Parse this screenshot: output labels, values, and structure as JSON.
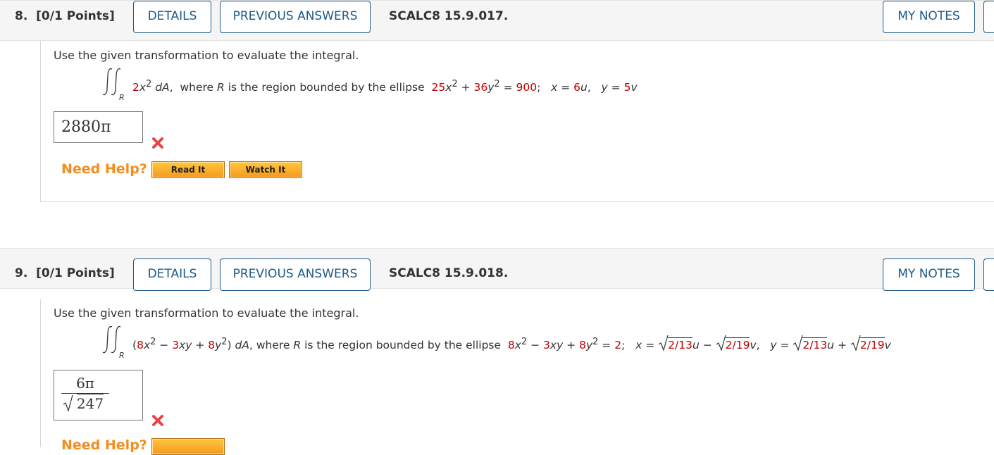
{
  "questions": [
    {
      "number": "8.",
      "points": "[0/1 Points]",
      "details_label": "DETAILS",
      "previous_answers_label": "PREVIOUS ANSWERS",
      "reference": "SCALC8 15.9.017.",
      "my_notes_label": "MY NOTES",
      "prompt": "Use the given transformation to evaluate the integral.",
      "integral_region": "R",
      "integrand": "2x² dA,",
      "description": "where R is the region bounded by the ellipse",
      "ellipse": "25x² + 36y² = 900;",
      "transform_x": "x = 6u,",
      "transform_y": "y = 5v",
      "answer": "2880π",
      "answer_status": "incorrect",
      "need_help_label": "Need Help?",
      "read_it_label": "Read It",
      "watch_it_label": "Watch It"
    },
    {
      "number": "9.",
      "points": "[0/1 Points]",
      "details_label": "DETAILS",
      "previous_answers_label": "PREVIOUS ANSWERS",
      "reference": "SCALC8 15.9.018.",
      "my_notes_label": "MY NOTES",
      "prompt": "Use the given transformation to evaluate the integral.",
      "integral_region": "R",
      "integrand": "(8x² − 3xy + 8y²) dA,",
      "description": "where R is the region bounded by the ellipse",
      "ellipse": "8x² − 3xy + 8y² = 2;",
      "transform_x": "x = √2/13 u − √2/19 v,",
      "transform_y": "y = √2/13 u + √2/19 v",
      "answer_numerator": "6π",
      "answer_denominator": "247",
      "answer_status": "incorrect",
      "need_help_label": "Need Help?"
    }
  ],
  "colors": {
    "button_border": "#1d5a86",
    "highlight_red": "#c00000",
    "need_help_orange": "#f38d1f",
    "incorrect_mark": "#e64545"
  }
}
